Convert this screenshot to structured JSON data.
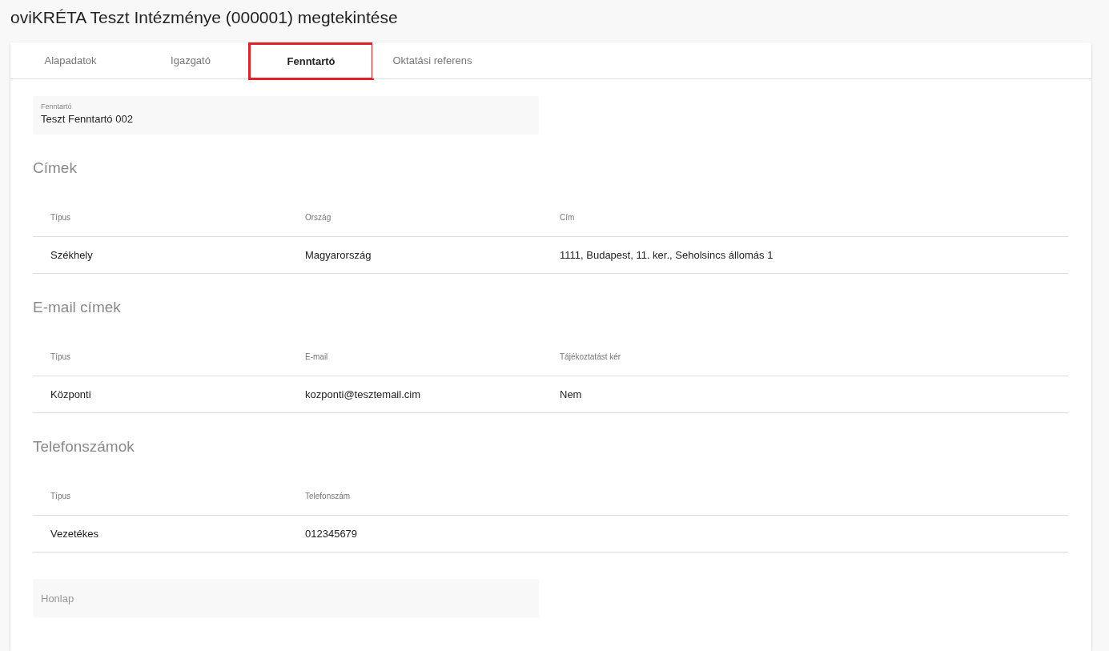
{
  "page_title": "oviKRÉTA Teszt Intézménye (000001) megtekintése",
  "tabs": [
    {
      "label": "Alapadatok",
      "selected": false
    },
    {
      "label": "Igazgató",
      "selected": false
    },
    {
      "label": "Fenntartó",
      "selected": true
    },
    {
      "label": "Oktatási referens",
      "selected": false
    }
  ],
  "fenntarto_field": {
    "label": "Fenntartó",
    "value": "Teszt Fenntartó 002"
  },
  "sections": [
    {
      "title": "Címek",
      "columns": [
        "Típus",
        "Ország",
        "Cím"
      ],
      "rows": [
        [
          "Székhely",
          "Magyarország",
          "1111, Budapest, 11. ker., Seholsincs állomás 1"
        ]
      ]
    },
    {
      "title": "E-mail címek",
      "columns": [
        "Típus",
        "E-mail",
        "Tájékoztatást kér"
      ],
      "rows": [
        [
          "Központi",
          "kozponti@tesztemail.cim",
          "Nem"
        ]
      ]
    },
    {
      "title": "Telefonszámok",
      "columns": [
        "Típus",
        "Telefonszám"
      ],
      "rows": [
        [
          "Vezetékes",
          "012345679"
        ]
      ]
    }
  ],
  "honlap_field": {
    "placeholder": "Honlap"
  }
}
